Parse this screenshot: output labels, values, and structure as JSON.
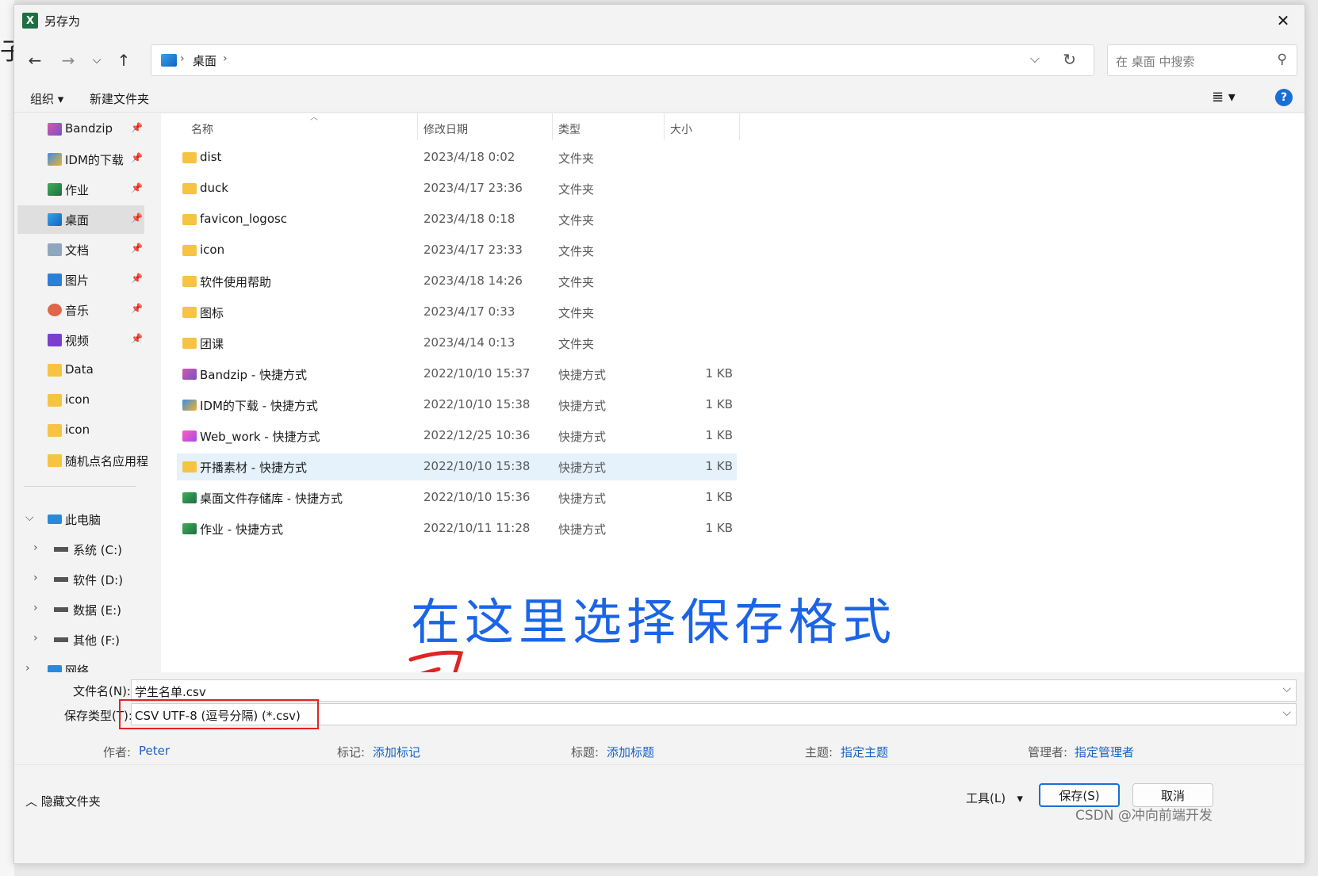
{
  "window": {
    "title": "另存为",
    "app_icon": "excel-icon"
  },
  "nav": {
    "address_segments": [
      "桌面"
    ],
    "search_placeholder": "在 桌面 中搜索"
  },
  "toolbar": {
    "organize": "组织 ▾",
    "new_folder": "新建文件夹"
  },
  "sidebar": {
    "quick_access": [
      {
        "label": "Bandzip",
        "pinned": true
      },
      {
        "label": "IDM的下载",
        "pinned": true
      },
      {
        "label": "作业",
        "pinned": true
      },
      {
        "label": "桌面",
        "pinned": true,
        "selected": true
      },
      {
        "label": "文档",
        "pinned": true
      },
      {
        "label": "图片",
        "pinned": true
      },
      {
        "label": "音乐",
        "pinned": true
      },
      {
        "label": "视频",
        "pinned": true
      },
      {
        "label": "Data",
        "pinned": false
      },
      {
        "label": "icon",
        "pinned": false
      },
      {
        "label": "icon",
        "pinned": false
      },
      {
        "label": "随机点名应用程",
        "pinned": false
      }
    ],
    "this_pc": "此电脑",
    "drives": [
      "系统 (C:)",
      "软件 (D:)",
      "数据 (E:)",
      "其他 (F:)"
    ],
    "network": "网络"
  },
  "columns": {
    "name": "名称",
    "modified": "修改日期",
    "type": "类型",
    "size": "大小"
  },
  "files": [
    {
      "name": "dist",
      "date": "2023/4/18 0:02",
      "type": "文件夹",
      "size": ""
    },
    {
      "name": "duck",
      "date": "2023/4/17 23:36",
      "type": "文件夹",
      "size": ""
    },
    {
      "name": "favicon_logosc",
      "date": "2023/4/18 0:18",
      "type": "文件夹",
      "size": ""
    },
    {
      "name": "icon",
      "date": "2023/4/17 23:33",
      "type": "文件夹",
      "size": ""
    },
    {
      "name": "软件使用帮助",
      "date": "2023/4/18 14:26",
      "type": "文件夹",
      "size": ""
    },
    {
      "name": "图标",
      "date": "2023/4/17 0:33",
      "type": "文件夹",
      "size": ""
    },
    {
      "name": "团课",
      "date": "2023/4/14 0:13",
      "type": "文件夹",
      "size": ""
    },
    {
      "name": "Bandzip - 快捷方式",
      "date": "2022/10/10 15:37",
      "type": "快捷方式",
      "size": "1 KB"
    },
    {
      "name": "IDM的下载 - 快捷方式",
      "date": "2022/10/10 15:38",
      "type": "快捷方式",
      "size": "1 KB"
    },
    {
      "name": "Web_work - 快捷方式",
      "date": "2022/12/25 10:36",
      "type": "快捷方式",
      "size": "1 KB"
    },
    {
      "name": "开播素材 - 快捷方式",
      "date": "2022/10/10 15:38",
      "type": "快捷方式",
      "size": "1 KB"
    },
    {
      "name": "桌面文件存储库 - 快捷方式",
      "date": "2022/10/10 15:36",
      "type": "快捷方式",
      "size": "1 KB"
    },
    {
      "name": "作业 - 快捷方式",
      "date": "2022/10/11 11:28",
      "type": "快捷方式",
      "size": "1 KB"
    }
  ],
  "annotation": "在这里选择保存格式",
  "fields": {
    "filename_label": "文件名(N):",
    "filename_value": "学生名单.csv",
    "filetype_label": "保存类型(T):",
    "filetype_value": "CSV UTF-8 (逗号分隔) (*.csv)"
  },
  "meta": {
    "author_label": "作者:",
    "author_value": "Peter",
    "tags_label": "标记:",
    "tags_value": "添加标记",
    "title_label": "标题:",
    "title_value": "添加标题",
    "subject_label": "主题:",
    "subject_value": "指定主题",
    "manager_label": "管理者:",
    "manager_value": "指定管理者"
  },
  "footer": {
    "hide_folders": "隐藏文件夹",
    "tools": "工具(L)",
    "save": "保存(S)",
    "cancel": "取消"
  },
  "watermark": "CSDN @冲向前端开发",
  "colors": {
    "accent": "#1a6fd6",
    "link": "#1a63c6",
    "annotation": "#1b64e6",
    "highlight_box": "#e02424",
    "selection": "#e5f1fb"
  }
}
